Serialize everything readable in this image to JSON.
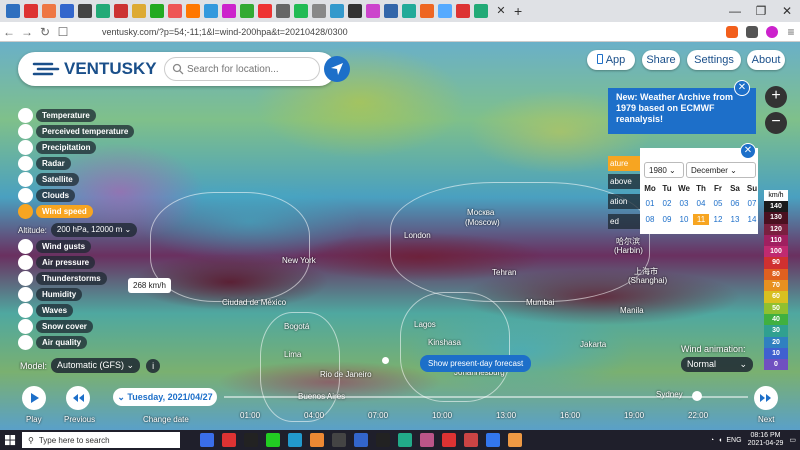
{
  "browser": {
    "tab_favicon_colors": [
      "#2f6fbf",
      "#d33",
      "#e74",
      "#36c",
      "#444",
      "#2a7",
      "#c33",
      "#da3",
      "#2a2",
      "#e55",
      "#f70",
      "#39d",
      "#c2c",
      "#3a3",
      "#e33",
      "#666",
      "#2b5",
      "#888",
      "#39c",
      "#333",
      "#c4c",
      "#36a",
      "#2a9",
      "#e62",
      "#5af",
      "#d33",
      "#2a7"
    ],
    "new_tab_label": "+",
    "tab_close_label": "✕",
    "window_controls": [
      "—",
      "❐",
      "✕"
    ],
    "url": "ventusky.com/?p=54;-11;1&l=wind-200hpa&t=20210428/0300",
    "extension_colors": [
      "#f25f1c",
      "#555",
      "#c2c"
    ]
  },
  "header": {
    "logo_text": "VENTUSKY",
    "search_placeholder": "Search for location...",
    "buttons": {
      "app": "App",
      "share": "Share",
      "settings": "Settings",
      "about": "About"
    }
  },
  "layers": [
    {
      "label": "Temperature",
      "icon": "thermometer-icon",
      "active": false
    },
    {
      "label": "Perceived temperature",
      "icon": "person-thermometer-icon",
      "active": false
    },
    {
      "label": "Precipitation",
      "icon": "raindrop-icon",
      "active": false
    },
    {
      "label": "Radar",
      "icon": "radar-icon",
      "active": false
    },
    {
      "label": "Satellite",
      "icon": "satellite-icon",
      "active": false
    },
    {
      "label": "Clouds",
      "icon": "cloud-icon",
      "active": false
    },
    {
      "label": "Wind speed",
      "icon": "wind-icon",
      "active": true
    },
    {
      "label": "Wind gusts",
      "icon": "wind-gust-icon",
      "active": false
    },
    {
      "label": "Air pressure",
      "icon": "pressure-icon",
      "active": false
    },
    {
      "label": "Thunderstorms",
      "icon": "lightning-icon",
      "active": false
    },
    {
      "label": "Humidity",
      "icon": "humidity-icon",
      "active": false
    },
    {
      "label": "Waves",
      "icon": "waves-icon",
      "active": false
    },
    {
      "label": "Snow cover",
      "icon": "snowflake-icon",
      "active": false
    },
    {
      "label": "Air quality",
      "icon": "air-quality-icon",
      "active": false
    }
  ],
  "altitude": {
    "label": "Altitude:",
    "value": "200 hPa, 12000 m"
  },
  "tooltip": "268 km/h",
  "model": {
    "label": "Model:",
    "value": "Automatic (GFS)",
    "info": "i"
  },
  "present_day": "Show present-day forecast",
  "wind_animation": {
    "label": "Wind animation:",
    "value": "Normal"
  },
  "cities": [
    {
      "name": "Москва"
    },
    {
      "name": "(Moscow)"
    },
    {
      "name": "London"
    },
    {
      "name": "New York"
    },
    {
      "name": "Tehran"
    },
    {
      "name": "哈尔滨"
    },
    {
      "name": "(Harbin)"
    },
    {
      "name": "上海市"
    },
    {
      "name": "(Shanghai)"
    },
    {
      "name": "Ciudad de México"
    },
    {
      "name": "Bogotá"
    },
    {
      "name": "Lima"
    },
    {
      "name": "Lagos"
    },
    {
      "name": "Kinshasa"
    },
    {
      "name": "Mumbai"
    },
    {
      "name": "Manila"
    },
    {
      "name": "Jakarta"
    },
    {
      "name": "Rio de Janeiro"
    },
    {
      "name": "Johannesburg"
    },
    {
      "name": "Sydney"
    },
    {
      "name": "Buenos Aires"
    }
  ],
  "news": {
    "text": "New: Weather Archive from 1979 based on ECMWF reanalysis!",
    "close": "✕"
  },
  "archive": {
    "year": "1980",
    "month": "December",
    "close": "✕",
    "weekdays": [
      "Mo",
      "Tu",
      "We",
      "Th",
      "Fr",
      "Sa",
      "Su"
    ],
    "row1": [
      "01",
      "02",
      "03",
      "04",
      "05",
      "06",
      "07"
    ],
    "row2": [
      "08",
      "09",
      "10",
      "11",
      "12",
      "13",
      "14"
    ],
    "selected_day": "11",
    "peeking_labels": [
      "ature",
      "above gro",
      "ation",
      "ed"
    ]
  },
  "zoom": {
    "in": "+",
    "out": "−"
  },
  "legend": {
    "unit": "km/h",
    "stops": [
      {
        "value": "140",
        "color": "#1a1a1a"
      },
      {
        "value": "130",
        "color": "#4a1020"
      },
      {
        "value": "120",
        "color": "#7a2040"
      },
      {
        "value": "110",
        "color": "#a02060"
      },
      {
        "value": "100",
        "color": "#c02a70"
      },
      {
        "value": "90",
        "color": "#d03030"
      },
      {
        "value": "80",
        "color": "#e06020"
      },
      {
        "value": "70",
        "color": "#e89020"
      },
      {
        "value": "60",
        "color": "#d8c020"
      },
      {
        "value": "50",
        "color": "#90c030"
      },
      {
        "value": "40",
        "color": "#40b040"
      },
      {
        "value": "30",
        "color": "#30a090"
      },
      {
        "value": "20",
        "color": "#3080c0"
      },
      {
        "value": "10",
        "color": "#4060d0"
      },
      {
        "value": "0",
        "color": "#7050c0"
      }
    ]
  },
  "timeline": {
    "play_label": "Play",
    "previous_label": "Previous",
    "change_date_label": "Change date",
    "date": "Tuesday, 2021/04/27",
    "next_label": "Next",
    "hours": [
      "01:00",
      "04:00",
      "07:00",
      "10:00",
      "13:00",
      "16:00",
      "19:00",
      "22:00"
    ]
  },
  "taskbar": {
    "search_placeholder": "Type here to search",
    "app_colors": [
      "#3a6ee8",
      "#d33",
      "#222",
      "#2c2",
      "#29c",
      "#e83",
      "#444",
      "#36c",
      "#222",
      "#2a8",
      "#b58",
      "#d33",
      "#c44",
      "#37e",
      "#e94"
    ],
    "lang": "ENG",
    "time": "08:16 PM",
    "date": "2021-04-29"
  }
}
